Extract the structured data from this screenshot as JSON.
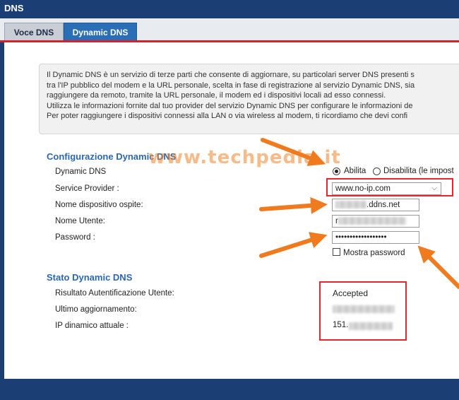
{
  "window": {
    "title": "DNS"
  },
  "tabs": [
    {
      "label": "Voce DNS",
      "active": false
    },
    {
      "label": "Dynamic DNS",
      "active": true
    }
  ],
  "info": {
    "lines": [
      "Il Dynamic DNS è un servizio di terze parti che consente di aggiornare, su particolari server DNS presenti s",
      "tra l'IP pubblico del modem e la URL personale, scelta in fase di registrazione al servizio Dynamic DNS, sia",
      "raggiungere da remoto, tramite la URL personale, il modem ed i dispositivi locali ad esso connessi.",
      "Utilizza le informazioni fornite dal tuo provider del servizio Dynamic DNS per configurare le informazioni de",
      "Per poter raggiungere i dispositivi connessi alla LAN o via wireless al modem, ti ricordiamo che devi confi"
    ]
  },
  "config": {
    "title": "Configurazione Dynamic DNS",
    "dynamic_dns_label": "Dynamic DNS",
    "enable_label": "Abilita",
    "disable_label": "Disabilita (le impost",
    "enabled": true,
    "service_provider_label": "Service Provider :",
    "service_provider_value": "www.no-ip.com",
    "hostname_label": "Nome dispositivo ospite:",
    "hostname_suffix": ".ddns.net",
    "username_label": "Nome Utente:",
    "username_prefix": "r",
    "password_label": "Password :",
    "password_mask": "••••••••••••••••••",
    "show_password_label": "Mostra password",
    "show_password_checked": false
  },
  "status": {
    "title": "Stato Dynamic DNS",
    "auth_label": "Risultato Autentificazione Utente:",
    "auth_value": "Accepted",
    "last_update_label": "Ultimo aggiornamento:",
    "ip_label": "IP dinamico attuale :",
    "ip_prefix": "151."
  },
  "watermark": "www.techpedia.it",
  "colors": {
    "header_bg": "#1b3f74",
    "tab_active": "#2a6fb6",
    "accent_red": "#d2232a",
    "section_title": "#2b67b0",
    "annotation_box": "#e8262d",
    "annotation_arrow": "#f07a1e"
  }
}
